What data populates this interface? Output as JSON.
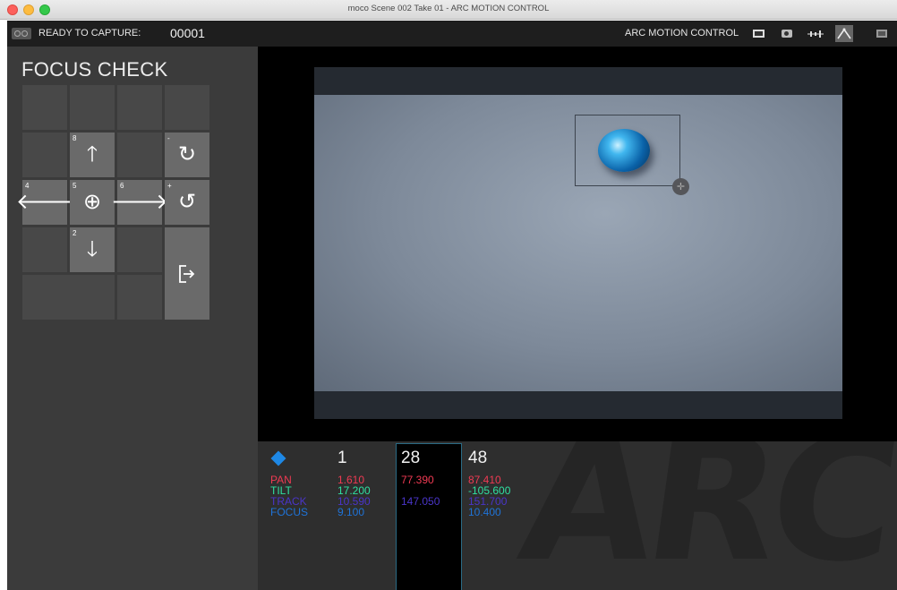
{
  "window": {
    "title": "moco  Scene 002  Take 01 - ARC MOTION CONTROL"
  },
  "toolbar": {
    "capture_label": "READY TO CAPTURE:",
    "capture_count": "00001",
    "brand_label": "ARC MOTION CONTROL",
    "icons": [
      "monitor-icon",
      "camera-icon",
      "timeline-icon",
      "curve-icon",
      "stack-icon"
    ],
    "active_icon": "curve-icon"
  },
  "panel": {
    "title": "FOCUS CHECK",
    "buttons": {
      "up": {
        "num": "8",
        "symbol": "🡑"
      },
      "down": {
        "num": "2",
        "symbol": "🡓"
      },
      "left": {
        "num": "4",
        "symbol": "🡐"
      },
      "right": {
        "num": "6",
        "symbol": "🡒"
      },
      "zoom": {
        "num": "5",
        "symbol": "⊕"
      },
      "rotate_cw": {
        "num": "-",
        "symbol": "↻"
      },
      "rotate_ccw": {
        "num": "+",
        "symbol": "↺"
      }
    }
  },
  "preview": {
    "accent": "#41b7ef"
  },
  "data_panel": {
    "axes": [
      {
        "label": "PAN",
        "color": "#ef3a53"
      },
      {
        "label": "TILT",
        "color": "#2fe0a0"
      },
      {
        "label": "TRACK",
        "color": "#4a35c9"
      },
      {
        "label": "FOCUS",
        "color": "#1f73d8"
      }
    ],
    "columns": [
      {
        "frame": "1",
        "pan": "1.610",
        "tilt": "17.200",
        "track": "10.590",
        "focus": "9.100"
      },
      {
        "frame": "28",
        "pan": "77.390",
        "tilt": "",
        "track": "147.050",
        "focus": ""
      },
      {
        "frame": "48",
        "pan": "87.410",
        "tilt": "-105.600",
        "track": "151.700",
        "focus": "10.400"
      }
    ],
    "logo_text": "ARC"
  }
}
